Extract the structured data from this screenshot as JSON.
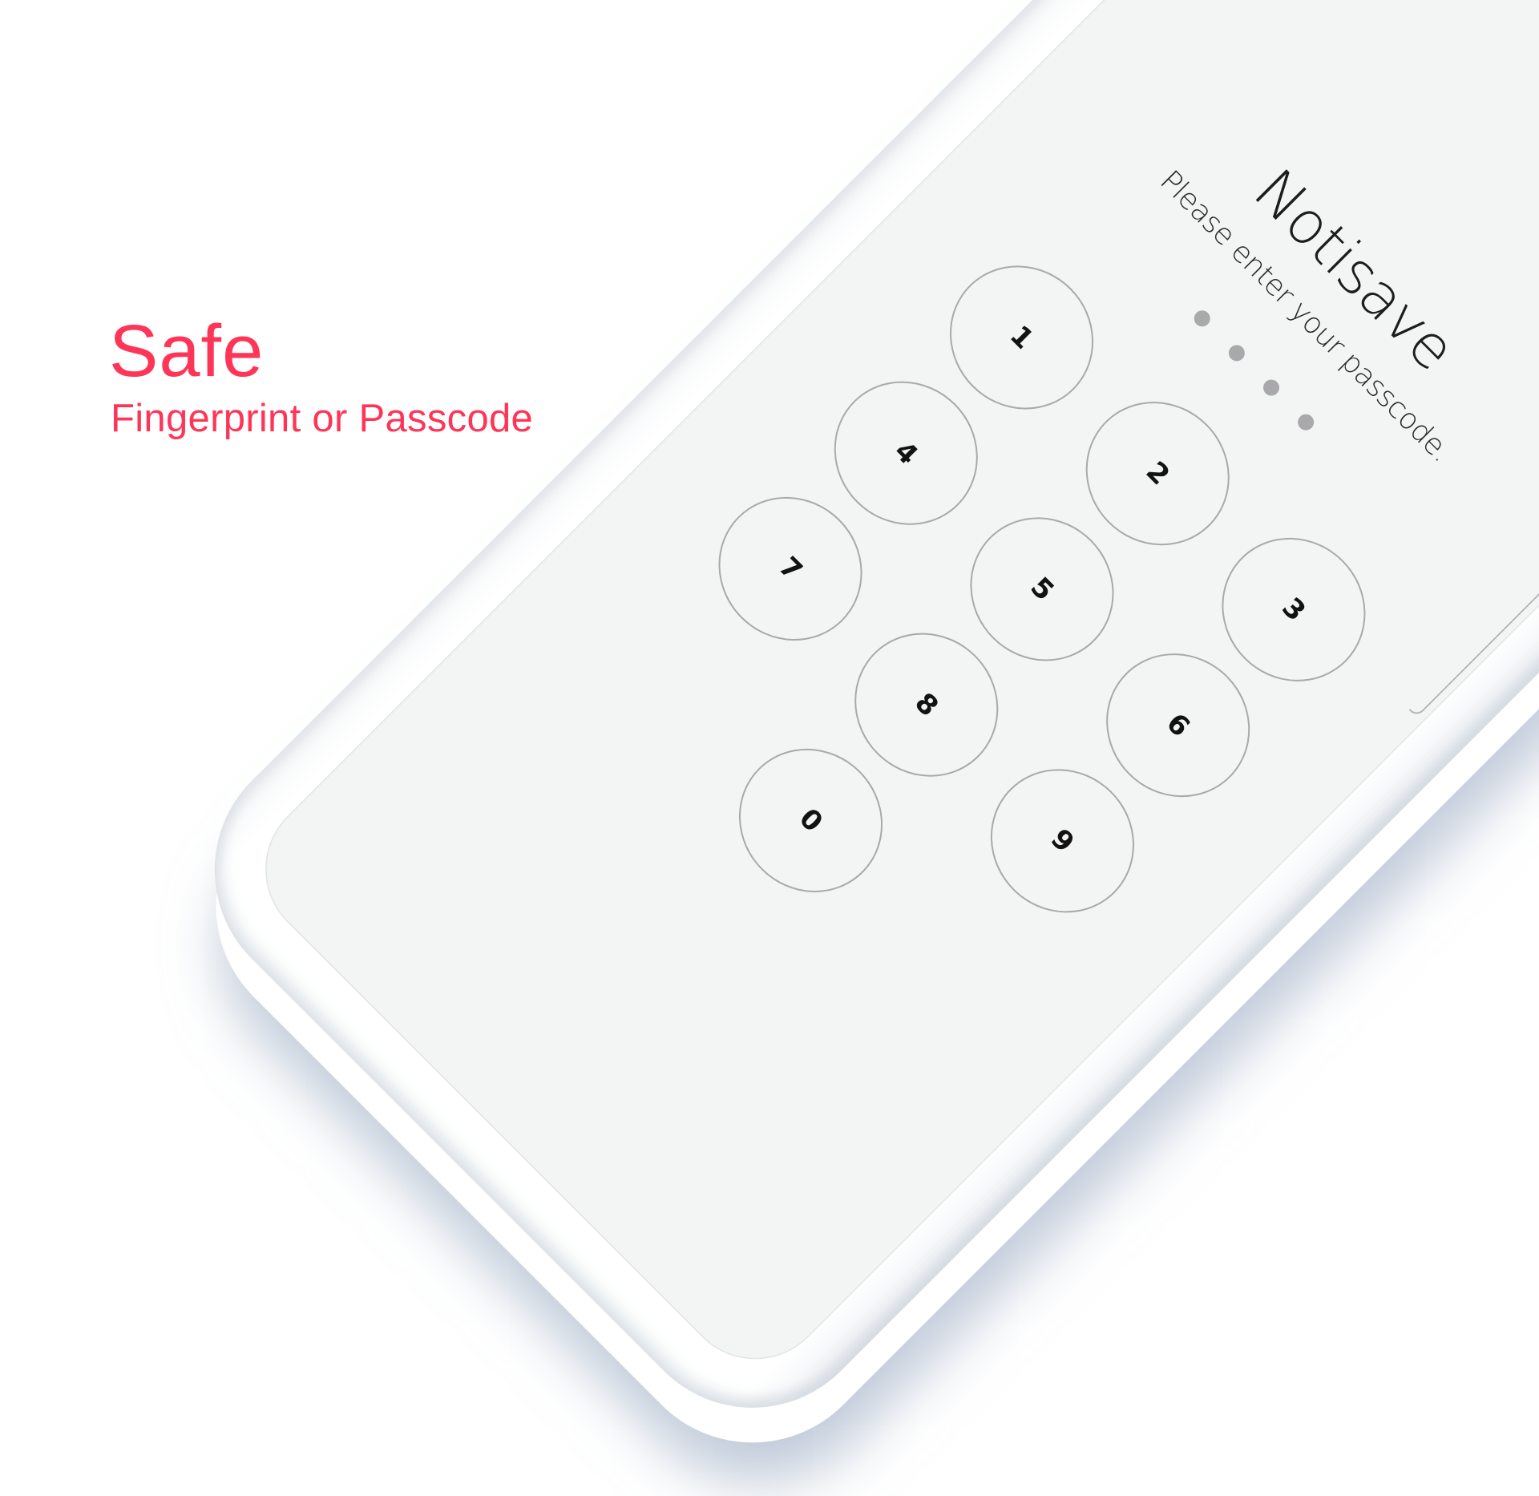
{
  "promo": {
    "headline": "Safe",
    "subline": "Fingerprint or Passcode",
    "accent_color": "#ff3558"
  },
  "lock_screen": {
    "app_name": "Notisave",
    "prompt": "Please enter your passcode.",
    "passcode_length": 4,
    "entered_digits": 0,
    "dot_color": "#a9a9ab",
    "background_color": "#f3f4f4",
    "keypad": {
      "rows": [
        [
          "1",
          "2",
          "3"
        ],
        [
          "4",
          "5",
          "6"
        ],
        [
          "7",
          "8",
          "9"
        ],
        [
          "",
          "0",
          ""
        ]
      ]
    }
  }
}
